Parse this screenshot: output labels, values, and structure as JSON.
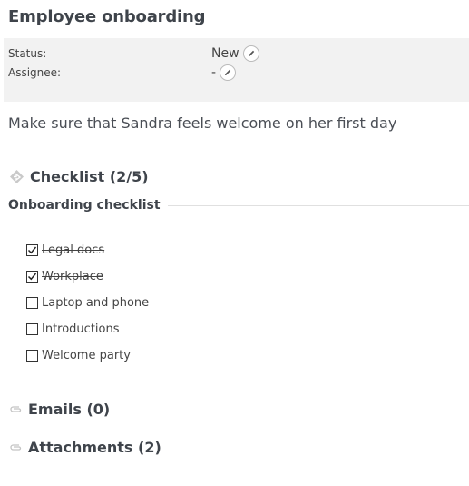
{
  "title": "Employee onboarding",
  "properties": {
    "status_label": "Status:",
    "status_value": "New",
    "assignee_label": "Assignee:",
    "assignee_value": "-"
  },
  "description": "Make sure that Sandra feels welcome on her first day",
  "checklist": {
    "heading": "Checklist (2/5)",
    "group_title": "Onboarding checklist",
    "items": [
      {
        "label": "Legal docs",
        "checked": true
      },
      {
        "label": "Workplace",
        "checked": true
      },
      {
        "label": "Laptop and phone",
        "checked": false
      },
      {
        "label": "Introductions",
        "checked": false
      },
      {
        "label": "Welcome party",
        "checked": false
      }
    ]
  },
  "emails": {
    "heading": "Emails (0)"
  },
  "attachments": {
    "heading": "Attachments (2)"
  },
  "icons": {
    "edit": "pencil-icon",
    "checklist": "checklist-diamond-icon",
    "emails": "paperclip-icon",
    "attachments": "paperclip-icon"
  }
}
